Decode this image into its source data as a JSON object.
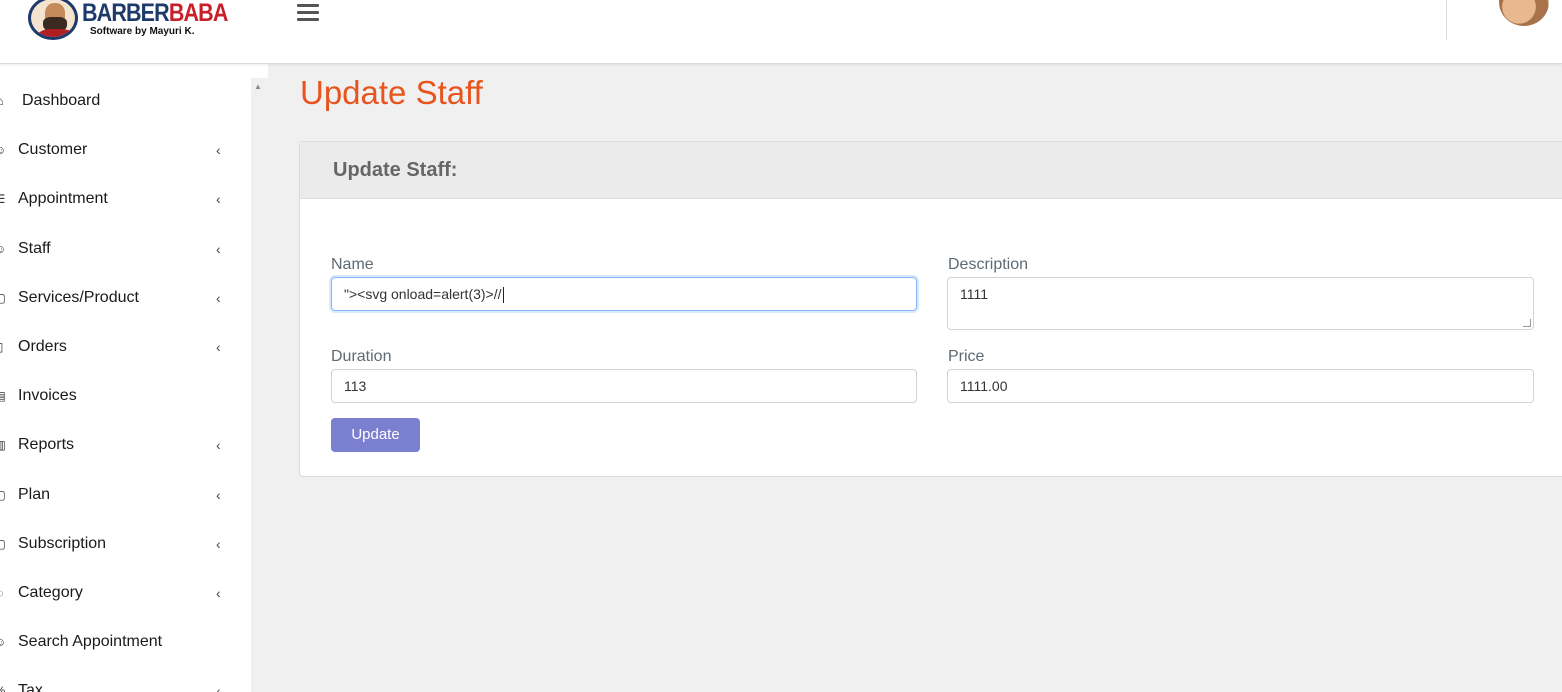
{
  "brand": {
    "name_part1": "BARBER",
    "name_part2": "BABA",
    "tagline": "Software  by Mayuri K."
  },
  "sidebar": {
    "items": [
      {
        "label": "Dashboard",
        "icon": "home-icon",
        "has_chevron": false
      },
      {
        "label": "Customer",
        "icon": "user-icon",
        "has_chevron": true
      },
      {
        "label": "Appointment",
        "icon": "list-icon",
        "has_chevron": true
      },
      {
        "label": "Staff",
        "icon": "user-icon",
        "has_chevron": true
      },
      {
        "label": "Services/Product",
        "icon": "box-icon",
        "has_chevron": true
      },
      {
        "label": "Orders",
        "icon": "cart-icon",
        "has_chevron": true
      },
      {
        "label": "Invoices",
        "icon": "invoice-icon",
        "has_chevron": false
      },
      {
        "label": "Reports",
        "icon": "report-icon",
        "has_chevron": true
      },
      {
        "label": "Plan",
        "icon": "plan-icon",
        "has_chevron": true
      },
      {
        "label": "Subscription",
        "icon": "subscription-icon",
        "has_chevron": true
      },
      {
        "label": "Category",
        "icon": "category-icon",
        "has_chevron": true
      },
      {
        "label": "Search Appointment",
        "icon": "search-user-icon",
        "has_chevron": false
      },
      {
        "label": "Tax",
        "icon": "tax-icon",
        "has_chevron": true
      }
    ],
    "chevron_glyph": "‹"
  },
  "page": {
    "title": "Update Staff"
  },
  "form": {
    "card_title": "Update Staff:",
    "name_label": "Name",
    "name_value": "\"><svg onload=alert(3)>//",
    "description_label": "Description",
    "description_value": "1111",
    "duration_label": "Duration",
    "duration_value": "113",
    "price_label": "Price",
    "price_value": "1111.00",
    "submit_label": "Update"
  },
  "colors": {
    "title_accent": "#e8541e",
    "button": "#7b7fcf",
    "brand_blue": "#1e3a6b",
    "brand_red": "#c8202a"
  }
}
